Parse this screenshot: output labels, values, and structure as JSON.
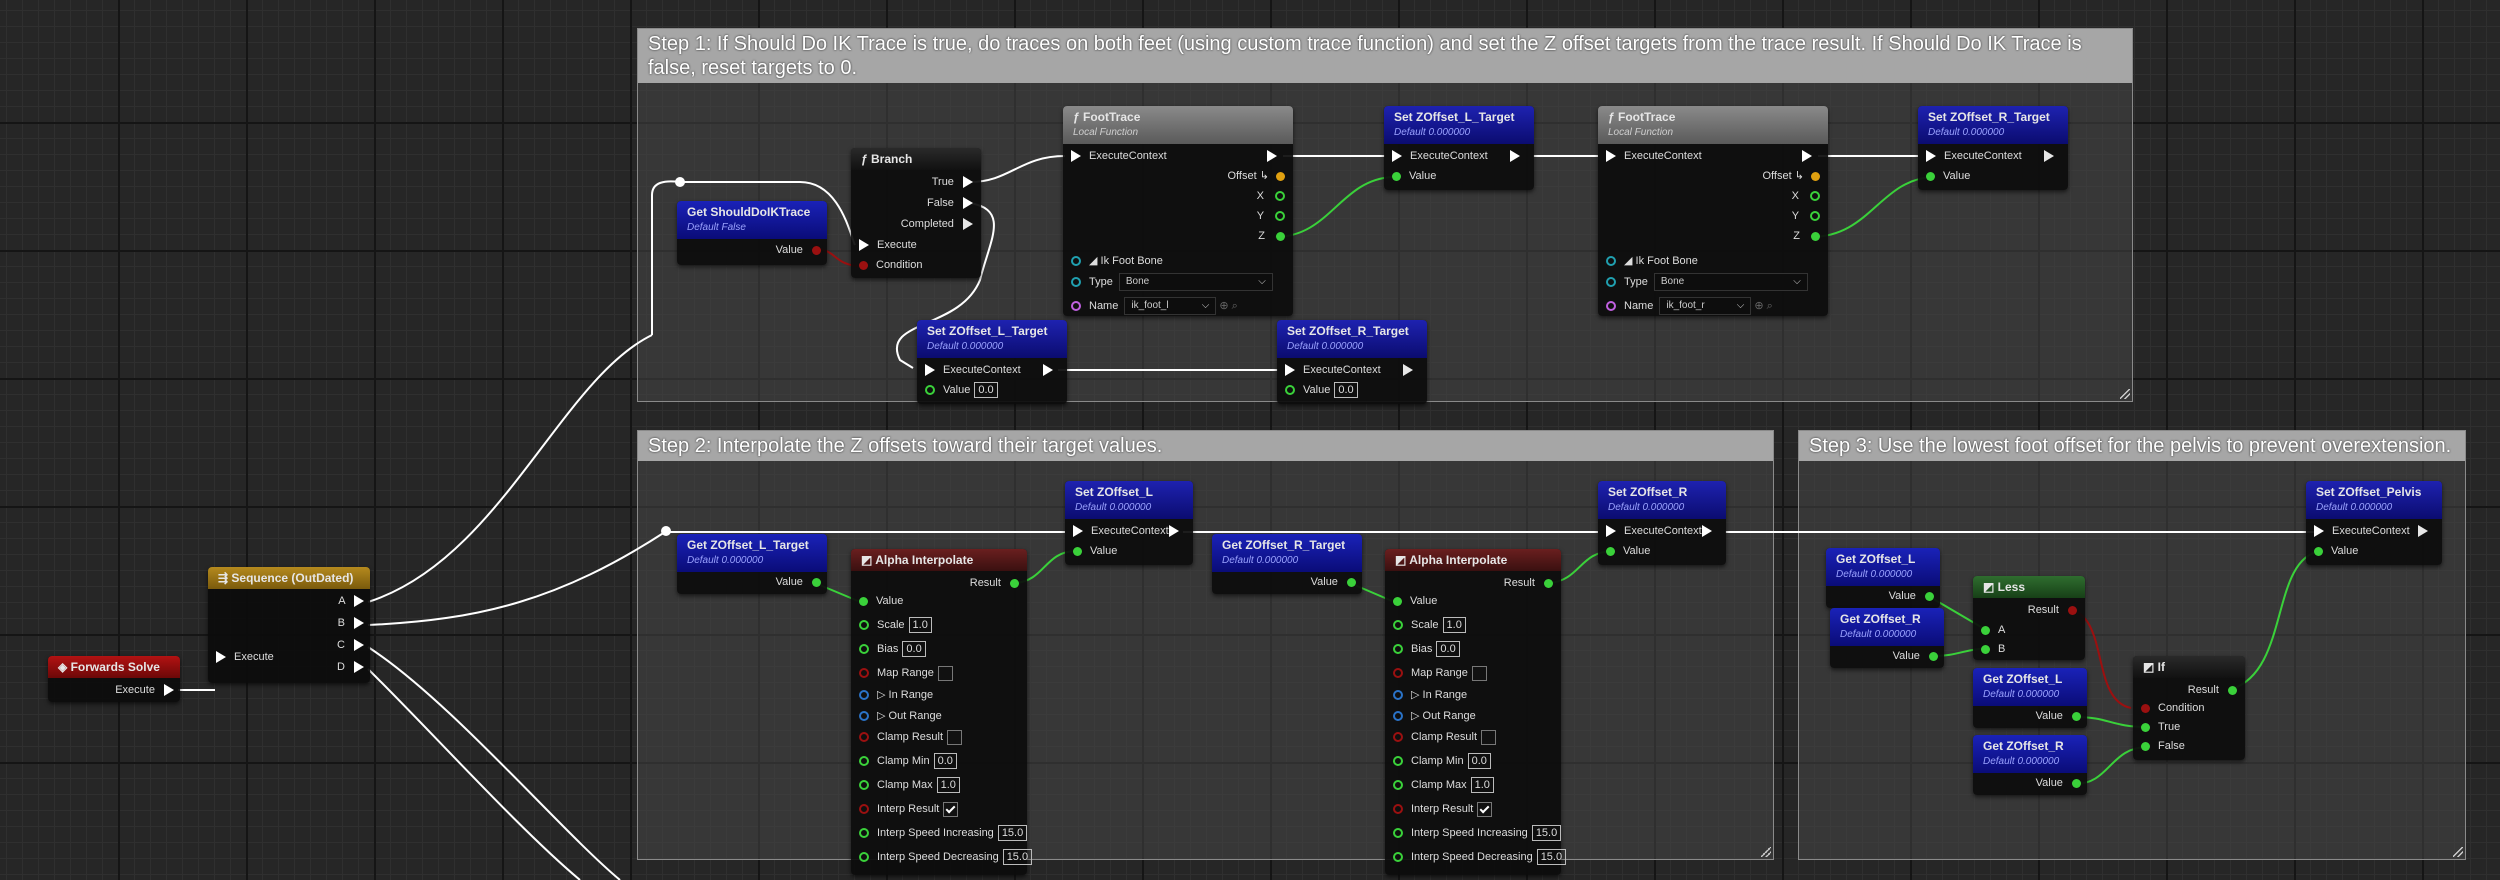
{
  "comments": {
    "step1": "Step 1: If Should Do IK Trace is true, do traces on both feet (using custom trace function) and set the Z offset targets from the trace result. If Should Do IK Trace is false, reset targets to 0.",
    "step2": "Step 2: Interpolate the Z offsets toward their target values.",
    "step3": "Step 3: Use the lowest foot offset for the pelvis to prevent overextension."
  },
  "labels": {
    "exec_context": "ExecuteContext",
    "value": "Value",
    "execute": "Execute",
    "result": "Result",
    "default_false": "Default False",
    "default_zero": "Default 0.000000",
    "local_function": "Local Function",
    "offset": "Offset",
    "x": "X",
    "y": "Y",
    "z": "Z",
    "ik_foot_bone": "Ik Foot Bone",
    "type": "Type",
    "name": "Name",
    "bone": "Bone",
    "true": "True",
    "false": "False",
    "completed": "Completed",
    "condition": "Condition",
    "a": "A",
    "b": "B",
    "c": "C",
    "d": "D",
    "alpha": {
      "value": "Value",
      "scale": "Scale",
      "bias": "Bias",
      "map_range": "Map Range",
      "in_range": "In Range",
      "out_range": "Out Range",
      "clamp_result": "Clamp Result",
      "clamp_min": "Clamp Min",
      "clamp_max": "Clamp Max",
      "interp_result": "Interp Result",
      "interp_inc": "Interp Speed Increasing",
      "interp_dec": "Interp Speed Decreasing"
    }
  },
  "values": {
    "zero": "0.0",
    "one": "1.0",
    "fifteen": "15.0",
    "foot_l": "ik_foot_l",
    "foot_r": "ik_foot_r"
  },
  "nodes": {
    "get_should_do": "Get ShouldDoIKTrace",
    "branch": "Branch",
    "foot_trace": "FootTrace",
    "set_zl_target": "Set ZOffset_L_Target",
    "set_zr_target": "Set ZOffset_R_Target",
    "get_zl_target": "Get ZOffset_L_Target",
    "get_zr_target": "Get ZOffset_R_Target",
    "alpha_interp": "Alpha Interpolate",
    "set_zl": "Set ZOffset_L",
    "set_zr": "Set ZOffset_R",
    "get_zl": "Get ZOffset_L",
    "get_zr": "Get ZOffset_R",
    "less": "Less",
    "if": "If",
    "set_pelvis": "Set ZOffset_Pelvis",
    "sequence": "Sequence (OutDated)",
    "forwards_solve": "Forwards Solve"
  },
  "colors": {
    "exec_wire": "#ffffff",
    "float_wire": "#3ad13a",
    "bool_wire": "#9b1010",
    "comment_header": "#a6a6a6"
  }
}
